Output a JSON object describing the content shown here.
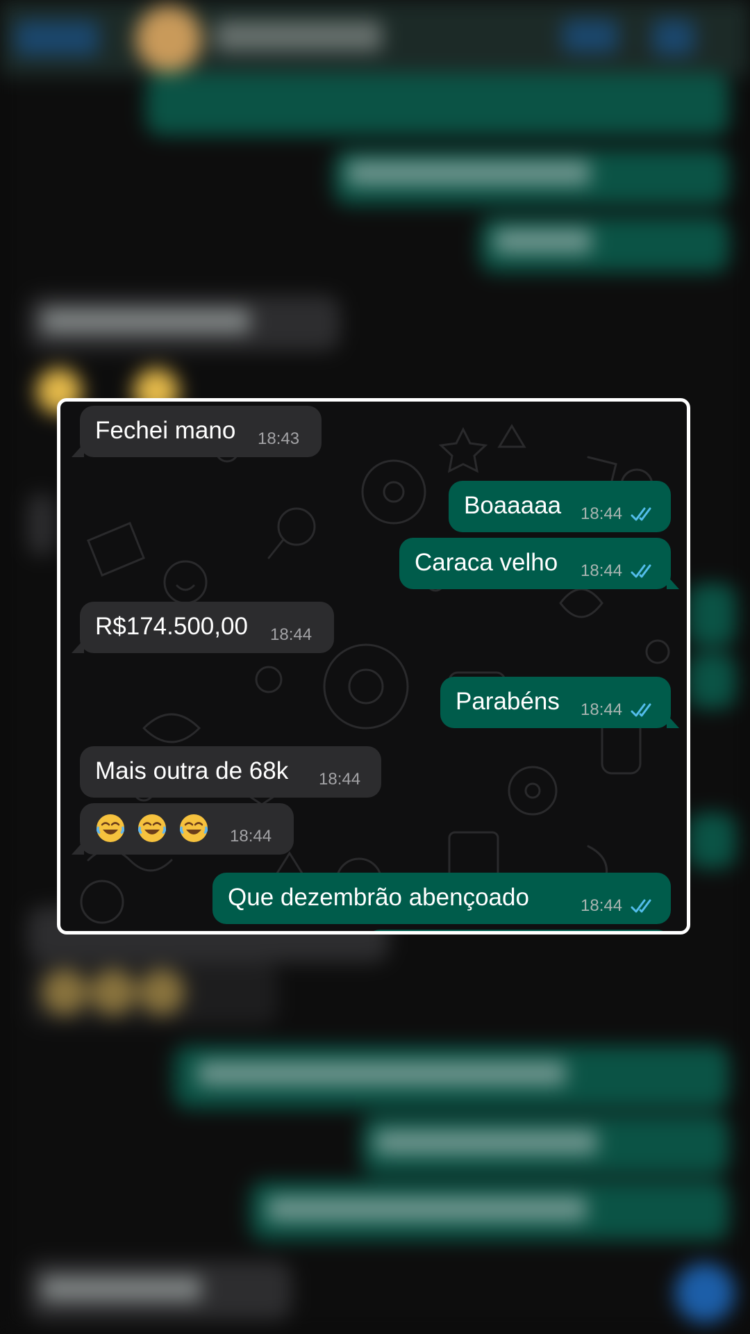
{
  "colors": {
    "incoming_bubble": "#2c2c2e",
    "outgoing_bubble": "#005c4b",
    "read_ticks": "#53bdeb",
    "panel_border": "#ffffff",
    "chat_background": "#0f0f10"
  },
  "icons": {
    "read_receipt": "double-check-icon",
    "laughing_emoji": "face-with-tears-of-joy-icon"
  },
  "messages": [
    {
      "direction": "incoming",
      "text": "Fechei mano",
      "time": "18:43"
    },
    {
      "direction": "outgoing",
      "text": "Boaaaaa",
      "time": "18:44",
      "status": "read"
    },
    {
      "direction": "outgoing",
      "text": "Caraca velho",
      "time": "18:44",
      "status": "read"
    },
    {
      "direction": "incoming",
      "text": "R$174.500,00",
      "time": "18:44"
    },
    {
      "direction": "outgoing",
      "text": "Parabéns",
      "time": "18:44",
      "status": "read"
    },
    {
      "direction": "incoming",
      "text": "Mais outra de 68k",
      "time": "18:44"
    },
    {
      "direction": "incoming",
      "emoji": [
        "😂",
        "😂",
        "😂"
      ],
      "time": "18:44"
    },
    {
      "direction": "outgoing",
      "text": "Que dezembrão abençoado",
      "time": "18:44",
      "status": "read"
    }
  ]
}
